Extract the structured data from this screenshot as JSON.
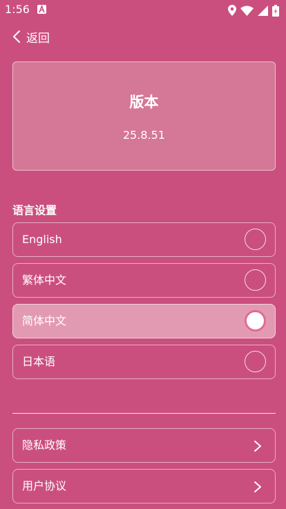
{
  "status_bar": {
    "time": "1:56",
    "icons": [
      "app-a-icon",
      "location-icon",
      "wifi-icon",
      "signal-icon",
      "battery-icon"
    ]
  },
  "nav": {
    "back_label": "返回"
  },
  "version_card": {
    "title": "版本",
    "version": "25.8.51"
  },
  "language_section": {
    "title": "语言设置",
    "options": [
      {
        "label": "English",
        "selected": false
      },
      {
        "label": "繁体中文",
        "selected": false
      },
      {
        "label": "简体中文",
        "selected": true
      },
      {
        "label": "日本语",
        "selected": false
      }
    ]
  },
  "links": [
    {
      "label": "隐私政策"
    },
    {
      "label": "用户协议"
    }
  ],
  "colors": {
    "background": "#cb4f7e",
    "card": "#d57796",
    "selected_row": "#e29ab3",
    "radio_ring": "#e26b92"
  }
}
